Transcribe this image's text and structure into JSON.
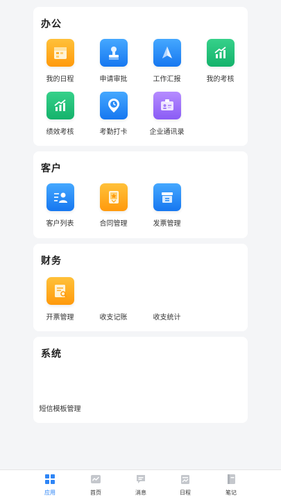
{
  "sections": {
    "office": {
      "title": "办公",
      "items": [
        {
          "label": "我的日程",
          "icon": "calendar-icon",
          "color": "#ffa51f"
        },
        {
          "label": "申请审批",
          "icon": "stamp-icon",
          "color": "#2a8cf7"
        },
        {
          "label": "工作汇报",
          "icon": "paper-plane-icon",
          "color": "#2a8cf7"
        },
        {
          "label": "我的考核",
          "icon": "growth-chart-icon",
          "color": "#1fc279"
        },
        {
          "label": "绩效考核",
          "icon": "growth-chart-icon",
          "color": "#1fc279"
        },
        {
          "label": "考勤打卡",
          "icon": "clock-pin-icon",
          "color": "#2a8cf7"
        },
        {
          "label": "企业通讯录",
          "icon": "contact-card-icon",
          "color": "#9d72f8"
        }
      ]
    },
    "customer": {
      "title": "客户",
      "items": [
        {
          "label": "客户列表",
          "icon": "customer-list-icon",
          "color": "#2a8cf7"
        },
        {
          "label": "合同管理",
          "icon": "contract-icon",
          "color": "#ffa51f"
        },
        {
          "label": "发票管理",
          "icon": "invoice-box-icon",
          "color": "#2a8cf7"
        }
      ]
    },
    "finance": {
      "title": "财务",
      "items": [
        {
          "label": "开票管理",
          "icon": "bill-icon",
          "color": "#ffa51f"
        },
        {
          "label": "收支记账"
        },
        {
          "label": "收支统计"
        }
      ]
    },
    "system": {
      "title": "系统",
      "items": [
        {
          "label": "短信模板管理"
        }
      ]
    }
  },
  "tabbar": {
    "items": [
      {
        "label": "应用",
        "icon": "apps-grid-icon",
        "active": true
      },
      {
        "label": "首页",
        "icon": "home-chart-icon"
      },
      {
        "label": "消息",
        "icon": "message-icon"
      },
      {
        "label": "日程",
        "icon": "schedule-icon"
      },
      {
        "label": "笔记",
        "icon": "notebook-icon"
      }
    ]
  },
  "colors": {
    "accent": "#2f86f6",
    "background": "#f4f5f7"
  }
}
